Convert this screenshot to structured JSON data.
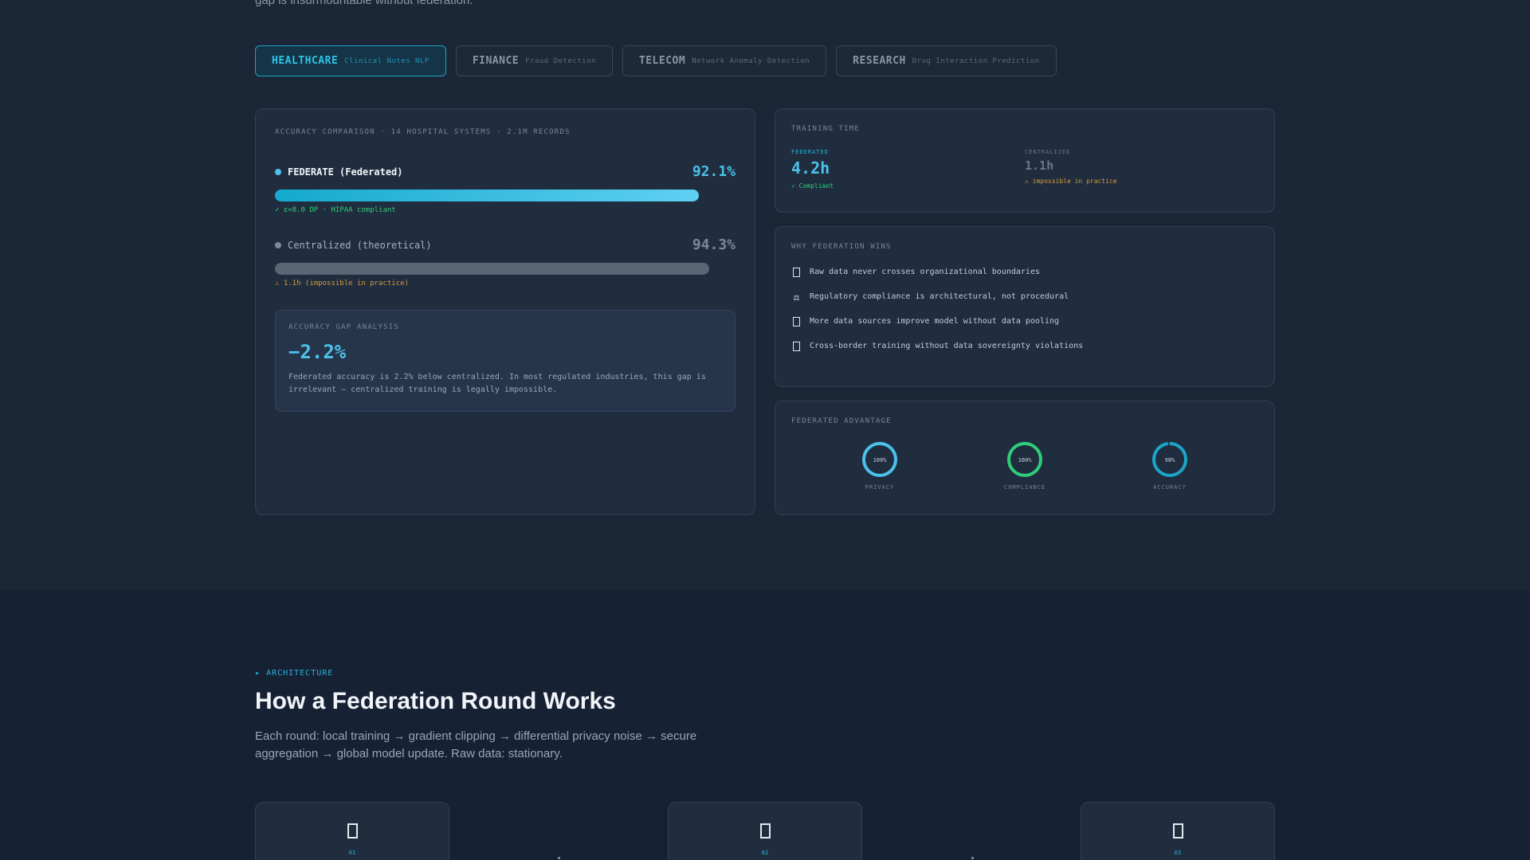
{
  "intro": {
    "cut_text": "gap is insurmountable without federation."
  },
  "tabs": [
    {
      "label": "HEALTHCARE",
      "sub": "Clinical Notes NLP",
      "active": true
    },
    {
      "label": "FINANCE",
      "sub": "Fraud Detection",
      "active": false
    },
    {
      "label": "TELECOM",
      "sub": "Network Anomaly Detection",
      "active": false
    },
    {
      "label": "RESEARCH",
      "sub": "Drug Interaction Prediction",
      "active": false
    }
  ],
  "accuracy": {
    "header": "ACCURACY COMPARISON · 14 HOSPITAL SYSTEMS · 2.1M RECORDS",
    "federated": {
      "name": "FEDERATE (Federated)",
      "value_text": "92.1%",
      "value": 92.1,
      "note": "✓ ε=8.0 DP · HIPAA compliant"
    },
    "centralized": {
      "name": "Centralized (theoretical)",
      "value_text": "94.3%",
      "value": 94.3,
      "note": "⚠ 1.1h (impossible in practice)"
    },
    "gap": {
      "label": "ACCURACY GAP ANALYSIS",
      "value": "−2.2%",
      "desc": "Federated accuracy is 2.2% below centralized. In most regulated industries, this gap is irrelevant — centralized training is legally impossible."
    }
  },
  "training": {
    "label": "TRAINING TIME",
    "federated": {
      "label": "FEDERATED",
      "value": "4.2h",
      "note": "✓ Compliant"
    },
    "centralized": {
      "label": "CENTRALIZED",
      "value": "1.1h",
      "note": "⚠ impossible in practice"
    }
  },
  "why": {
    "label": "WHY FEDERATION WINS",
    "items": [
      {
        "icon": "lock-icon",
        "text": "Raw data never crosses organizational boundaries"
      },
      {
        "icon": "scales-icon",
        "text": "Regulatory compliance is architectural, not procedural"
      },
      {
        "icon": "chart-icon",
        "text": "More data sources improve model without data pooling"
      },
      {
        "icon": "globe-icon",
        "text": "Cross-border training without data sovereignty violations"
      }
    ],
    "scales_glyph": "⚖"
  },
  "advantage": {
    "label": "FEDERATED ADVANTAGE",
    "gauges": [
      {
        "name": "PRIVACY",
        "value_text": "100%",
        "value": 100,
        "color": "#4cc2ea"
      },
      {
        "name": "COMPLIANCE",
        "value_text": "100%",
        "value": 100,
        "color": "#2ecf79"
      },
      {
        "name": "ACCURACY",
        "value_text": "98%",
        "value": 98,
        "color": "#1aa6c8"
      }
    ]
  },
  "architecture": {
    "kicker": "▸ ARCHITECTURE",
    "title": "How a Federation Round Works",
    "desc": "Each round: local training → gradient clipping → differential privacy noise → secure aggregation → global model update. Raw data: stationary.",
    "steps": [
      {
        "num": "01"
      },
      {
        "num": "02"
      },
      {
        "num": "03"
      }
    ]
  },
  "colors": {
    "accent": "#2cc3e6",
    "green": "#2ecf79",
    "warning": "#e0a63a",
    "bg": "#1b2637"
  }
}
